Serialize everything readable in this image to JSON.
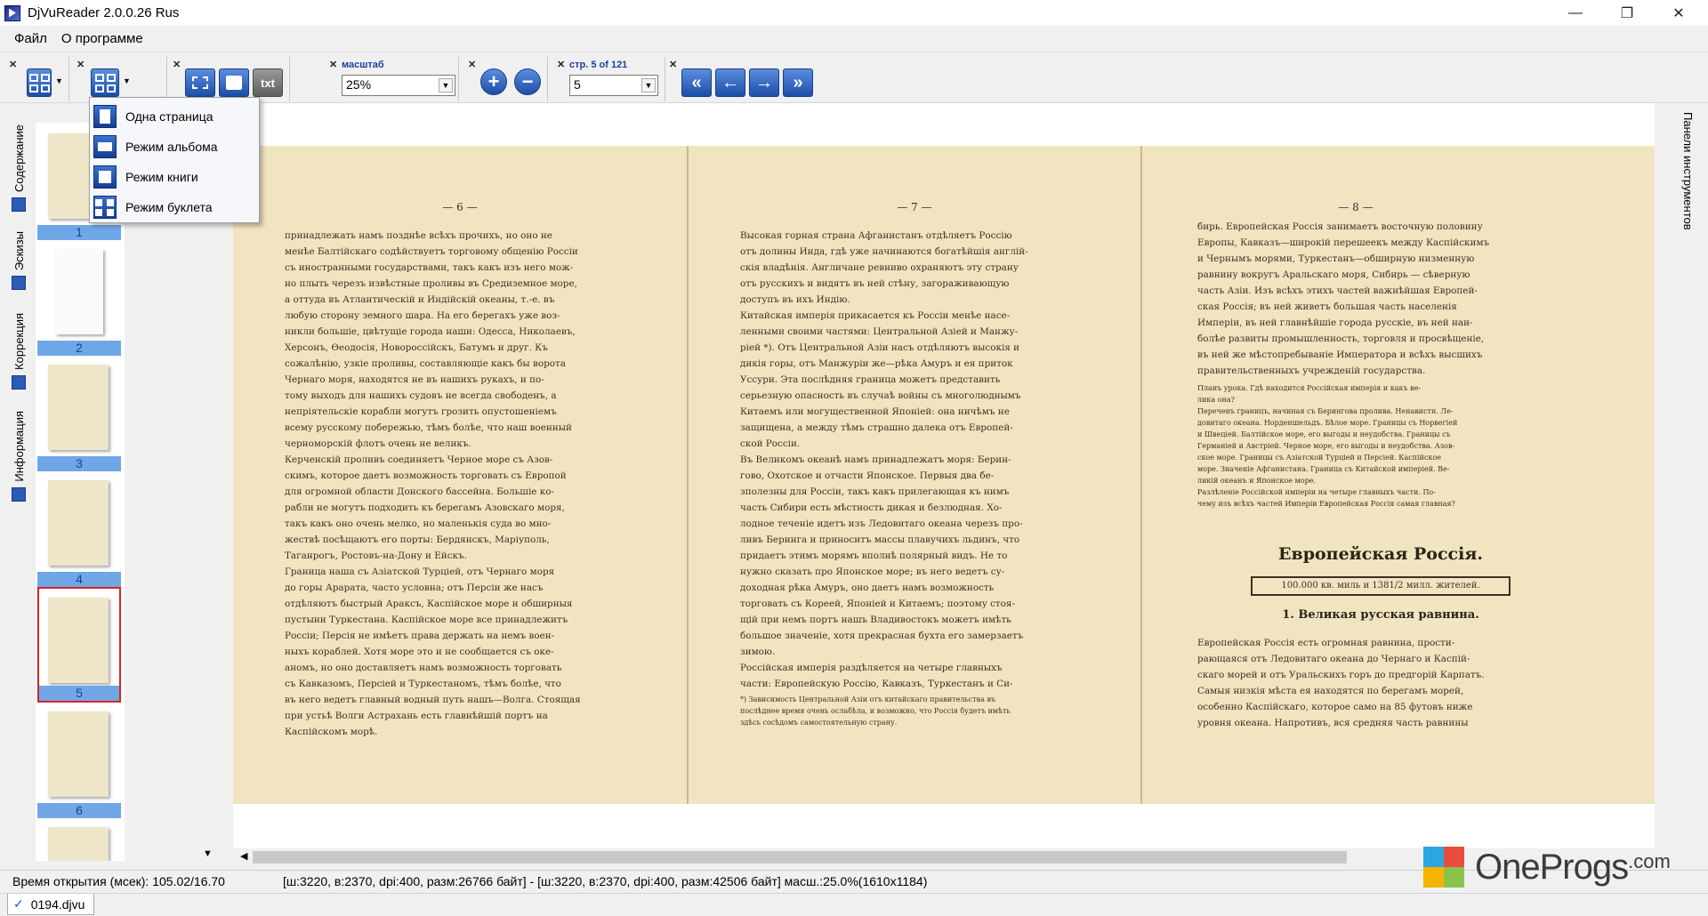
{
  "window": {
    "title": "DjVuReader 2.0.0.26 Rus",
    "minimize": "—",
    "restore": "❐",
    "close": "✕"
  },
  "menu": [
    "Файл",
    "О программе"
  ],
  "toolbar": {
    "zoom_label": "масштаб",
    "zoom_value": "25%",
    "page_label": "стр. 5 of 121",
    "page_value": "5",
    "text_button": "txt"
  },
  "view_menu": {
    "items": [
      {
        "label": "Одна страница",
        "icon": "single-page-icon"
      },
      {
        "label": "Режим альбома",
        "icon": "album-mode-icon"
      },
      {
        "label": "Режим книги",
        "icon": "book-mode-icon"
      },
      {
        "label": "Режим буклета",
        "icon": "booklet-mode-icon"
      }
    ]
  },
  "left_tabs": [
    "Содержание",
    "Эскизы",
    "Коррекция",
    "Информация"
  ],
  "thumbnails": [
    {
      "num": "1",
      "selected": false
    },
    {
      "num": "2",
      "selected": false
    },
    {
      "num": "3",
      "selected": false
    },
    {
      "num": "4",
      "selected": false
    },
    {
      "num": "5",
      "selected": true
    },
    {
      "num": "6",
      "selected": false
    }
  ],
  "right_panel": {
    "label": "Панели инструментов"
  },
  "pages": {
    "p6": {
      "num": "— 6 —",
      "text": "принадлежать намъ позднѣе всѣхъ прочихъ, но оно не\nменѣе Балтійскаго содѣйствуетъ торговому общенію Россіи\nсъ иностранными государствами, такъ какъ изъ него мож-\nно плыть черезъ извѣстные проливы въ Средиземное море,\nа оттуда въ Атлантическій и Индійскій океаны, т.-е. въ\nлюбую сторону земного шара. На его берегахъ уже воз-\nникли большіе, цвѣтущіе города наши: Одесса, Николаевъ,\nХерсонъ, Ѳеодосія, Новороссійскъ, Батумъ и друг. Къ\nсожалѣнію, узкіе проливы, составляющіе какъ бы ворота\nЧернаго моря, находятся не въ нашихъ рукахъ, и по-\nтому выходъ для нашихъ судовъ не всегда свободенъ, а\nнепріятельскіе корабли могутъ грозить опустошеніемъ\nвсему русскому побережью, тѣмъ болѣе, что наш военный\nчерноморскій флотъ очень не великъ.\nКерченскій проливъ соединяетъ Черное море съ Азов-\nскимъ, которое даетъ возможность торговать съ Европой\nдля огромной области Донского бассейна. Большіе ко-\nрабли не могутъ подходить къ берегамъ Азовскаго моря,\nтакъ какъ оно очень мелко, но маленькія суда во мно-\nжествѣ посѣщаютъ его порты: Бердянскъ, Маріуполь,\nТаганрогъ, Ростовъ-на-Дону и Ейскъ.\nГраница наша съ Азіатской Турціей, отъ Чернаго моря\nдо горы Арарата, часто условна; отъ Персіи же насъ\nотдѣляютъ быстрый Араксъ, Каспійское море и обширныя\nпустыни Туркестана. Каспійское море все принадлежитъ\nРоссіи; Персія не имѣетъ права держать на немъ воен-\nныхъ кораблей. Хотя море это и не сообщается съ оке-\nаномъ, но оно доставляетъ намъ возможность торговать\nсъ Кавказомъ, Персіей и Туркестаномъ, тѣмъ болѣе, что\nвъ него ведетъ главный водный путь нашъ—Волга. Стоящая\nпри устьѣ Волги Астрахань есть главнѣйшій портъ на\nКаспійскомъ морѣ."
    },
    "p7": {
      "num": "— 7 —",
      "text": "Высокая горная страна Афганистанъ отдѣляетъ Россію\nотъ долины Инда, гдѣ уже начинаются богатѣйшія англій-\nскія владѣнія. Англичане ревниво охраняютъ эту страну\nотъ русскихъ и видятъ въ ней стѣну, загораживающую\nдоступъ въ ихъ Индію.\nКитайская имперія прикасается къ Россіи менѣе насе-\nленными своими частями: Центральной Азіей и Манжу-\nріей *). Отъ Центральной Азіи насъ отдѣляютъ высокія и\nдикія горы, отъ Манжуріи же—рѣка Амуръ и ея приток\nУссури. Эта послѣдняя граница можетъ представить\nсерьезную опасность въ случаѣ войны съ многолюднымъ\nКитаемъ или могущественной Японіей: она ничѣмъ не\nзащищена, а между тѣмъ страшно далека отъ Европей-\nской Россіи.\nВъ Великомъ океанѣ намъ принадлежатъ моря: Берин-\nгово, Охотское и отчасти Японское. Первыя два бе-\nзполезны для Россіи, такъ какъ прилегающая къ нимъ\nчасть Сибири есть мѣстность дикая и безлюдная. Хо-\nлодное теченіе идетъ изъ Ледовитаго океана черезъ про-\nливъ Беринга и приноситъ массы плавучихъ льдинъ, что\nпридаетъ этимъ морямъ вполнѣ полярный видъ. Не то\nнужно сказать про Японское море; въ него ведетъ су-\nдоходная рѣка Амуръ, оно даетъ намъ возможность\nторговать съ Кореей, Японіей и Китаемъ; поэтому стоя-\nщій при немъ портъ нашъ Владивостокъ можетъ имѣть\nбольшое значеніе, хотя прекрасная бухта его замерзаетъ\nзимою.\nРоссійская имперія раздѣляется на четыре главныхъ\nчасти: Европейскую Россію, Кавказъ, Туркестанъ и Си-",
      "footnote": "*) Зависимость Центральной Азіи отъ китайскаго правительства въ\nпослѣднее время очень ослабѣла, и возможно, что Россія будетъ имѣть\nздѣсь сосѣдомъ самостоятельную страну."
    },
    "p8": {
      "num": "— 8 —",
      "text": "бирь. Европейская Россія занимаетъ восточную половину\nЕвропы, Кавказъ—широкій перешеекъ между Каспійскимъ\nи Чернымъ морями, Туркестанъ—обширную низменную\nравнину вокругъ Аральскаго моря, Сибирь — сѣверную\nчасть Азіи. Изъ всѣхъ этихъ частей важнѣйшая Европей-\nская Россія; въ ней живетъ большая часть населенія\nИмперіи, въ ней главнѣйшіе города русскіе, въ ней наи-\nболѣе развиты промышленность, торговля и просвѣщеніе,\nвъ ней же мѣстопребываніе Императора и всѣхъ высшихъ\nправительственныхъ учрежденій государства.",
      "lesson": "Планъ урока. Гдѣ находится Россійская имперія и какъ ве-\nлика она?\nПереченъ границъ, начиная съ Берингова пролива. Ненавистн. Ле-\nдовитаго океана. Норденшельдъ. Бѣлое море. Границы съ Норвегіей\nи Швеціей. Балтійское море, его выгоды и неудобства. Границы съ\nГерманіей и Австріей. Черное море, его выгоды и неудобства. Азов-\nское море. Границы съ Азіатской Турціей и Персіей. Каспійское\nморе. Значеніе Афганистана. Граница съ Китайской имперіей. Ве-\nликій океанъ и Японское море.\nРазлѣленіе Россійской имперіи на четыре главныхъ части. По-\nчему изъ всѣхъ частей Имперіи Европейская Россія самая главная?",
      "heading": "Европейская Россія.",
      "box": "100.000 кв. миль и 1381/2 милл. жителей.",
      "subheading": "1. Великая русская равнина.",
      "text2": "Европейская Россія есть огромная равнина, прости-\nрающаяся отъ Ледовитаго океана до Чернаго и Каспій-\nскаго морей и отъ Уральскихъ горъ до предгорій Карпатъ.\nСамыя низкія мѣста ея находятся по берегамъ морей,\nособенно Каспійскаго, которое само на 85 футовъ ниже\nуровня океана. Напротивъ, вся средняя часть равнины"
    }
  },
  "status": {
    "open_time": "Время открытия (мсек): 105.02/16.70",
    "info": "[ш:3220, в:2370, dpi:400, разм:26766 байт] - [ш:3220, в:2370, dpi:400, разм:42506 байт] масш.:25.0%(1610x1184)"
  },
  "file_tab": "0194.djvu",
  "watermark": {
    "text": "OneProgs",
    "suffix": ".com"
  },
  "colors": {
    "accent": "#2a5cb8",
    "selection": "#e02020",
    "thumb_label": "#6fa7e6",
    "paper": "#f1e4c0"
  }
}
